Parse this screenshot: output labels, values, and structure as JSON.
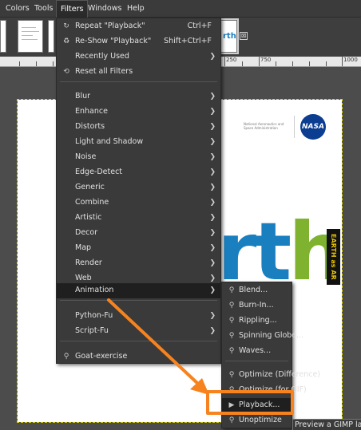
{
  "menubar": {
    "items": [
      {
        "label": "Colors"
      },
      {
        "label": "Tools"
      },
      {
        "label": "Filters"
      },
      {
        "label": "Windows"
      },
      {
        "label": "Help"
      }
    ]
  },
  "tabs": {
    "close_glyph": "⊠"
  },
  "ruler": {
    "labels": [
      "250",
      "750",
      "1000"
    ]
  },
  "canvas": {
    "nasa_caption": "National Aeronautics and Space Administration",
    "nasa_logo_text": "NASA",
    "big_text_part1": "rt",
    "big_text_part2": "h",
    "side_banner": "EARTH as AR"
  },
  "filters_menu": {
    "items": [
      {
        "icon": "repeat-icon",
        "glyph": "↻",
        "label": "Repeat \"Playback\"",
        "shortcut": "Ctrl+F"
      },
      {
        "icon": "reshow-icon",
        "glyph": "♻",
        "label": "Re-Show \"Playback\"",
        "shortcut": "Shift+Ctrl+F"
      },
      {
        "icon": "",
        "glyph": "",
        "label": "Recently Used",
        "submenu": true
      },
      {
        "icon": "reset-icon",
        "glyph": "⟲",
        "label": "Reset all Filters"
      },
      {
        "icon": "",
        "glyph": "",
        "label": "Blur",
        "submenu": true
      },
      {
        "icon": "",
        "glyph": "",
        "label": "Enhance",
        "submenu": true
      },
      {
        "icon": "",
        "glyph": "",
        "label": "Distorts",
        "submenu": true
      },
      {
        "icon": "",
        "glyph": "",
        "label": "Light and Shadow",
        "submenu": true
      },
      {
        "icon": "",
        "glyph": "",
        "label": "Noise",
        "submenu": true
      },
      {
        "icon": "",
        "glyph": "",
        "label": "Edge-Detect",
        "submenu": true
      },
      {
        "icon": "",
        "glyph": "",
        "label": "Generic",
        "submenu": true
      },
      {
        "icon": "",
        "glyph": "",
        "label": "Combine",
        "submenu": true
      },
      {
        "icon": "",
        "glyph": "",
        "label": "Artistic",
        "submenu": true
      },
      {
        "icon": "",
        "glyph": "",
        "label": "Decor",
        "submenu": true
      },
      {
        "icon": "",
        "glyph": "",
        "label": "Map",
        "submenu": true
      },
      {
        "icon": "",
        "glyph": "",
        "label": "Render",
        "submenu": true
      },
      {
        "icon": "",
        "glyph": "",
        "label": "Web",
        "submenu": true
      },
      {
        "icon": "",
        "glyph": "",
        "label": "Animation",
        "submenu": true,
        "highlighted": true
      },
      {
        "icon": "",
        "glyph": "",
        "label": "Python-Fu",
        "submenu": true
      },
      {
        "icon": "",
        "glyph": "",
        "label": "Script-Fu",
        "submenu": true
      },
      {
        "icon": "plugin-icon",
        "glyph": "⚲",
        "label": "Goat-exercise"
      }
    ]
  },
  "animation_menu": {
    "items": [
      {
        "icon": "plugin-icon",
        "glyph": "⚲",
        "label": "Blend..."
      },
      {
        "icon": "plugin-icon",
        "glyph": "⚲",
        "label": "Burn-In..."
      },
      {
        "icon": "plugin-icon",
        "glyph": "⚲",
        "label": "Rippling..."
      },
      {
        "icon": "plugin-icon",
        "glyph": "⚲",
        "label": "Spinning Globe..."
      },
      {
        "icon": "plugin-icon",
        "glyph": "⚲",
        "label": "Waves..."
      },
      {
        "icon": "plugin-icon",
        "glyph": "⚲",
        "label": "Optimize (Difference)"
      },
      {
        "icon": "plugin-icon",
        "glyph": "⚲",
        "label": "Optimize (for GIF)"
      },
      {
        "icon": "play-icon",
        "glyph": "▶",
        "label": "Playback...",
        "highlighted": true
      },
      {
        "icon": "plugin-icon",
        "glyph": "⚲",
        "label": "Unoptimize"
      }
    ]
  },
  "tooltip": {
    "text": "Preview a GIMP la"
  },
  "annotation": {
    "color": "#f7831f"
  }
}
